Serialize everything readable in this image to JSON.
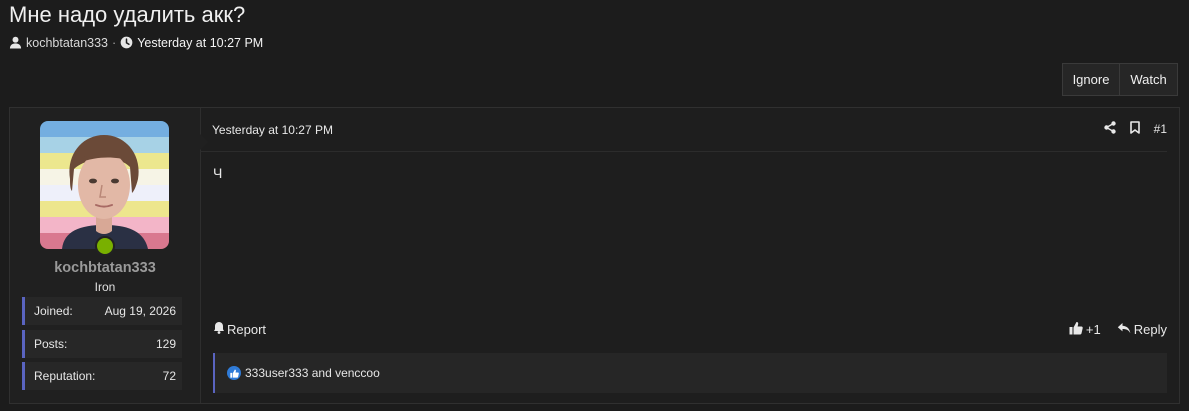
{
  "thread": {
    "title": "Мне надо удалить акк?",
    "author": "kochbtatan333",
    "separator": "·",
    "time": "Yesterday at 10:27 PM"
  },
  "buttons": {
    "ignore": "Ignore",
    "watch": "Watch"
  },
  "user": {
    "name": "kochbtatan333",
    "rank": "Iron",
    "stats": [
      {
        "label": "Joined:",
        "value": "Aug 19, 2026"
      },
      {
        "label": "Posts:",
        "value": "129"
      },
      {
        "label": "Reputation:",
        "value": "72"
      }
    ],
    "online_color": "#79b000"
  },
  "post": {
    "time": "Yesterday at 10:27 PM",
    "number": "#1",
    "body": "Ч",
    "report": "Report",
    "like_count": "+1",
    "reply": "Reply",
    "reactions_text": "333user333 and venccoo"
  },
  "icons": [
    "user-icon",
    "clock-icon",
    "share-icon",
    "bookmark-icon",
    "bell-icon",
    "thumbs-up-icon",
    "reply-icon",
    "like-badge-icon"
  ],
  "colors": {
    "accent": "#5a64c0",
    "like": "#2f7bd8",
    "background": "#1c1c1c"
  }
}
